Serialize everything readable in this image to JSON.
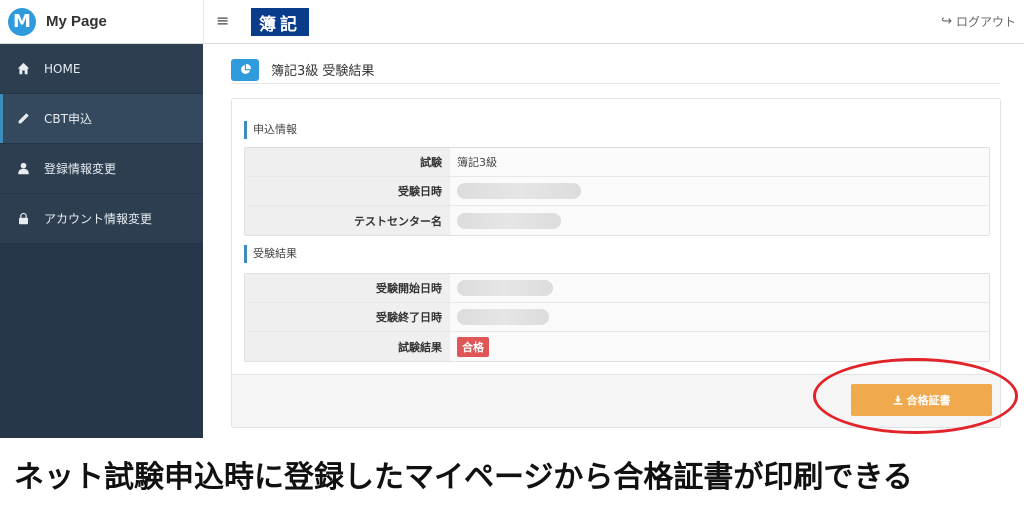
{
  "brand": {
    "logo_letter": "M",
    "title": "My Page"
  },
  "topbar": {
    "menu_icon": "hamburger-icon",
    "logo_text": "簿記",
    "logout_label": "ログアウト",
    "logout_icon": "sign-out-icon"
  },
  "sidebar": {
    "items": [
      {
        "label": "HOME",
        "icon": "home-icon",
        "active": false
      },
      {
        "label": "CBT申込",
        "icon": "pencil-icon",
        "active": true
      },
      {
        "label": "登録情報変更",
        "icon": "user-icon",
        "active": false
      },
      {
        "label": "アカウント情報変更",
        "icon": "lock-icon",
        "active": false
      }
    ]
  },
  "main": {
    "page_title": "簿記3級 受験結果",
    "page_icon": "pie-chart-icon",
    "application_section": {
      "label": "申込情報",
      "rows": [
        {
          "key": "試験",
          "value": "簿記3級"
        },
        {
          "key": "受験日時",
          "value": ""
        },
        {
          "key": "テストセンター名",
          "value": ""
        }
      ]
    },
    "result_section": {
      "label": "受験結果",
      "rows": [
        {
          "key": "受験開始日時",
          "value": ""
        },
        {
          "key": "受験終了日時",
          "value": ""
        },
        {
          "key": "試験結果",
          "value": "合格"
        }
      ]
    },
    "certificate_button": {
      "label": "合格証書",
      "icon": "download-icon"
    }
  },
  "caption": "ネット試験申込時に登録したマイページから合格証書が印刷できる",
  "colors": {
    "sidebar": "#2c3e50",
    "accent": "#2f9bdc",
    "button": "#f0a94d",
    "badge": "#e05555",
    "highlight": "#e2232a",
    "logo": "#0a3c8c"
  }
}
